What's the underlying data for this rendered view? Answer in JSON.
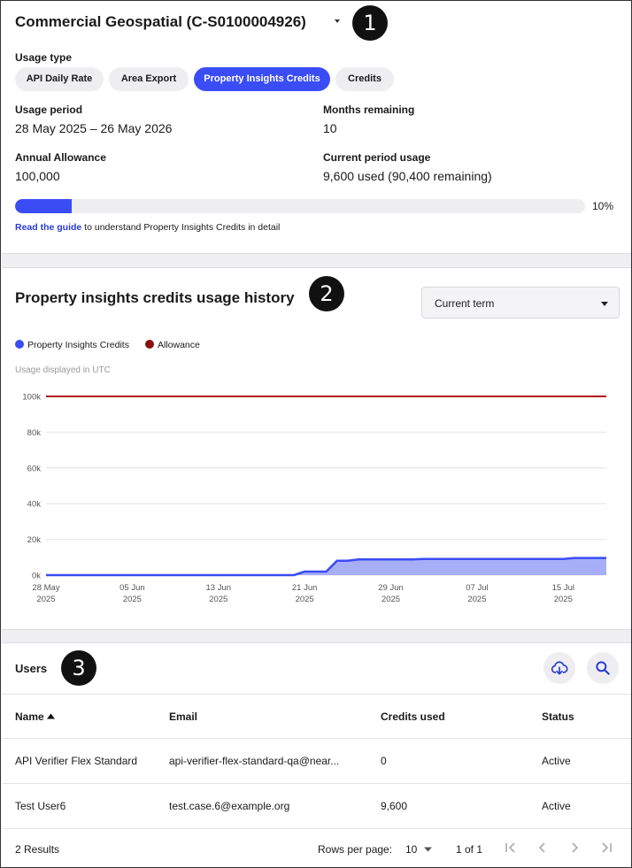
{
  "header": {
    "title": "Commercial Geospatial (C-S0100004926)"
  },
  "badges": {
    "one": "1",
    "two": "2",
    "three": "3"
  },
  "usage_type": {
    "label": "Usage type",
    "chips": [
      "API Daily Rate",
      "Area Export",
      "Property Insights Credits",
      "Credits"
    ],
    "active": "Property Insights Credits"
  },
  "usage_period": {
    "label": "Usage period",
    "value": "28 May 2025 – 26 May 2026"
  },
  "months_remaining": {
    "label": "Months remaining",
    "value": "10"
  },
  "annual_allowance": {
    "label": "Annual Allowance",
    "value": "100,000"
  },
  "current_usage": {
    "label": "Current period usage",
    "value": "9,600 used (90,400 remaining)"
  },
  "progress": {
    "percent": 10,
    "percent_label": "10%"
  },
  "guide": {
    "link": "Read the guide",
    "text": " to understand Property Insights Credits in detail"
  },
  "history": {
    "title": "Property insights credits usage history",
    "select_value": "Current term",
    "utc_note": "Usage displayed in UTC"
  },
  "colors": {
    "accent": "#3a4df5",
    "allowance": "#b01818",
    "area_fill": "#a6aef8"
  },
  "chart_data": {
    "type": "area",
    "legend": [
      {
        "name": "Property Insights Credits",
        "color": "#3a4df5"
      },
      {
        "name": "Allowance",
        "color": "#8b1010"
      }
    ],
    "y_ticks": [
      "100k",
      "80k",
      "60k",
      "40k",
      "20k",
      "0k"
    ],
    "ylim": [
      0,
      100000
    ],
    "x_ticks": [
      {
        "date": "2025-05-28",
        "line1": "28 May",
        "line2": "2025"
      },
      {
        "date": "2025-06-05",
        "line1": "05 Jun",
        "line2": "2025"
      },
      {
        "date": "2025-06-13",
        "line1": "13 Jun",
        "line2": "2025"
      },
      {
        "date": "2025-06-21",
        "line1": "21 Jun",
        "line2": "2025"
      },
      {
        "date": "2025-06-29",
        "line1": "29 Jun",
        "line2": "2025"
      },
      {
        "date": "2025-07-07",
        "line1": "07 Jul",
        "line2": "2025"
      },
      {
        "date": "2025-07-15",
        "line1": "15 Jul",
        "line2": "2025"
      }
    ],
    "xlim": [
      "2025-05-28",
      "2025-07-19"
    ],
    "series": [
      {
        "name": "Property Insights Credits",
        "points": [
          [
            "2025-05-28",
            0
          ],
          [
            "2025-06-20",
            0
          ],
          [
            "2025-06-21",
            2000
          ],
          [
            "2025-06-23",
            2000
          ],
          [
            "2025-06-24",
            8000
          ],
          [
            "2025-06-25",
            8000
          ],
          [
            "2025-06-26",
            8800
          ],
          [
            "2025-07-01",
            8800
          ],
          [
            "2025-07-02",
            9000
          ],
          [
            "2025-07-15",
            9000
          ],
          [
            "2025-07-16",
            9600
          ],
          [
            "2025-07-19",
            9600
          ]
        ]
      },
      {
        "name": "Allowance",
        "points": [
          [
            "2025-05-28",
            100000
          ],
          [
            "2025-07-19",
            100000
          ]
        ]
      }
    ]
  },
  "users": {
    "title": "Users",
    "columns": [
      "Name",
      "Email",
      "Credits used",
      "Status"
    ],
    "rows": [
      {
        "name": "API Verifier Flex Standard",
        "email": "api-verifier-flex-standard-qa@near...",
        "credits": "0",
        "status": "Active"
      },
      {
        "name": "Test User6",
        "email": "test.case.6@example.org",
        "credits": "9,600",
        "status": "Active"
      }
    ],
    "results": "2 Results",
    "rows_per_page_label": "Rows per page:",
    "rows_per_page": "10",
    "page_info": "1 of 1"
  }
}
